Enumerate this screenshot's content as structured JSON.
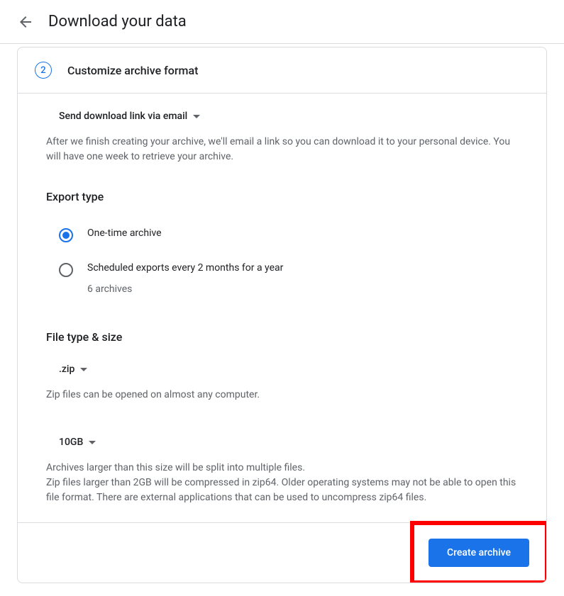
{
  "header": {
    "title": "Download your data"
  },
  "step": {
    "number": "2",
    "title": "Customize archive format"
  },
  "delivery": {
    "selected": "Send download link via email",
    "description": "After we finish creating your archive, we'll email a link so you can download it to your personal device. You will have one week to retrieve your archive."
  },
  "exportType": {
    "heading": "Export type",
    "options": [
      {
        "label": "One-time archive",
        "selected": true
      },
      {
        "label": "Scheduled exports every 2 months for a year",
        "sublabel": "6 archives",
        "selected": false
      }
    ]
  },
  "fileTypeSize": {
    "heading": "File type & size",
    "fileType": {
      "selected": ".zip",
      "description": "Zip files can be opened on almost any computer."
    },
    "size": {
      "selected": "10GB",
      "description": "Archives larger than this size will be split into multiple files.\nZip files larger than 2GB will be compressed in zip64. Older operating systems may not be able to open this file format. There are external applications that can be used to uncompress zip64 files."
    }
  },
  "actions": {
    "createArchive": "Create archive"
  }
}
